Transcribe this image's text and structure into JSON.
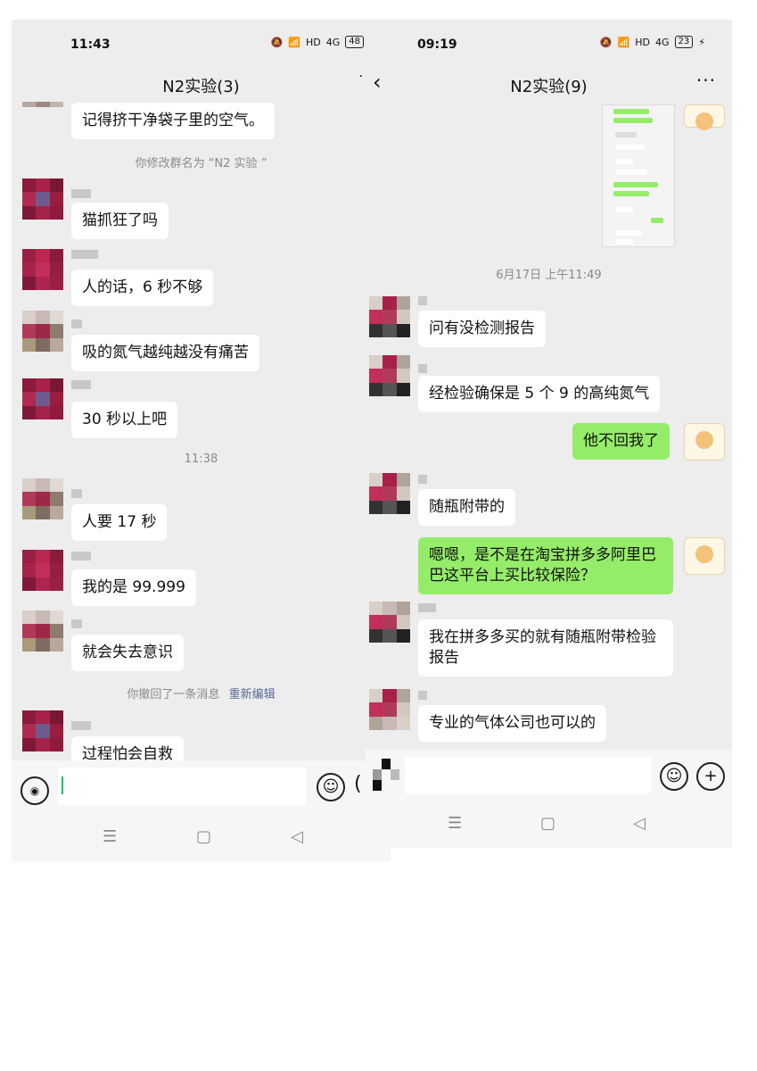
{
  "left": {
    "status": {
      "time": "11:43",
      "battery": "48"
    },
    "title": "N2实验(3)",
    "messages": {
      "m0": "记得挤干净袋子里的空气。",
      "sys_rename": "你修改群名为 “N2 实验 ”",
      "m1": "猫抓狂了吗",
      "m2": "人的话，6 秒不够",
      "m3": "吸的氮气越纯越没有痛苦",
      "m4": "30 秒以上吧",
      "time_1138": "11:38",
      "m5": "人要 17 秒",
      "m6": "我的是 99.999",
      "m7": "就会失去意识",
      "sys_recall": "你撤回了一条消息",
      "sys_reedit": "重新编辑",
      "m8": "过程怕会自救"
    },
    "nav": {
      "menu": "☰",
      "home": "▢",
      "back": "◁"
    }
  },
  "right": {
    "status": {
      "time": "09:19",
      "battery": "23"
    },
    "title": "N2实验(9)",
    "messages": {
      "time_0617": "6月17日 上午11:49",
      "r1": "问有没检测报告",
      "r2": "经检验确保是 5 个 9 的高纯氮气",
      "r3": "他不回我了",
      "r4": "随瓶附带的",
      "r5": "嗯嗯，是不是在淘宝拼多多阿里巴巴这平台上买比较保险？",
      "r6": "我在拼多多买的就有随瓶附带检验报告",
      "r7": "专业的气体公司也可以的"
    },
    "nav": {
      "menu": "☰",
      "home": "▢",
      "back": "◁"
    }
  },
  "icons": {
    "mute": "mute-bell-icon",
    "wifi": "wifi-icon",
    "hd": "HD",
    "signal": "4G",
    "back": "‹",
    "more": "···",
    "emoji": "☺",
    "plus": "+",
    "voice": "voice-icon"
  },
  "colors": {
    "chat_bg": "#ededed",
    "bubble_self": "#95ec69",
    "bubble_other": "#ffffff",
    "link": "#576b95"
  }
}
